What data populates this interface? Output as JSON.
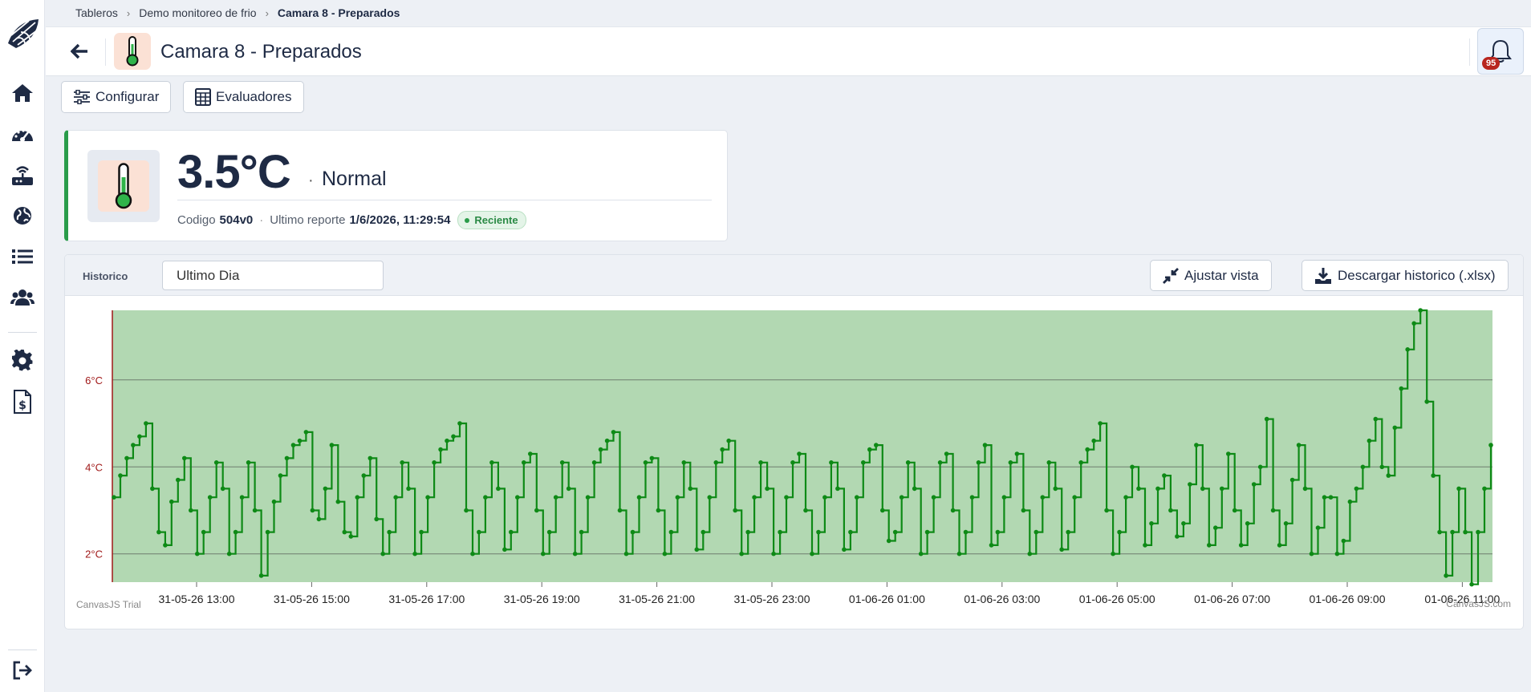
{
  "breadcrumb": [
    {
      "label": "Tableros"
    },
    {
      "label": "Demo monitoreo de frio"
    },
    {
      "label": "Camara 8 - Preparados"
    }
  ],
  "header": {
    "title": "Camara 8 - Preparados",
    "notifications_count": "95"
  },
  "toolbar": {
    "configure_label": "Configurar",
    "evaluators_label": "Evaluadores"
  },
  "status": {
    "temperature": "3.5°C",
    "separator": "·",
    "state": "Normal",
    "code_label": "Codigo",
    "code_value": "504v0",
    "report_label": "Ultimo reporte",
    "report_value": "1/6/2026, 11:29:54",
    "recent_label": "Reciente",
    "accent_color": "#2a9c4a"
  },
  "history": {
    "label": "Historico",
    "range_value": "Ultimo Dia",
    "fit_view_label": "Ajustar vista",
    "download_label": "Descargar historico (.xlsx)"
  },
  "sidebar": {
    "items": [
      {
        "icon": "home-icon"
      },
      {
        "icon": "dashboard-gauge-icon"
      },
      {
        "icon": "router-icon"
      },
      {
        "icon": "globe-icon"
      },
      {
        "icon": "list-icon"
      },
      {
        "icon": "users-icon"
      },
      {
        "icon": "gear-icon"
      },
      {
        "icon": "invoice-icon"
      }
    ],
    "logout_icon": "logout-icon"
  },
  "chart_data": {
    "type": "line",
    "step": true,
    "title": "",
    "xlabel": "",
    "ylabel": "",
    "x_start": "31-05-26 11:34",
    "x_end": "01-06-26 11:29",
    "ylim": [
      1.35,
      7.6
    ],
    "y_ticks": [
      "2°C",
      "4°C",
      "6°C"
    ],
    "y_tick_values": [
      2,
      4,
      6
    ],
    "x_tick_labels": [
      "31-05-26 13:00",
      "31-05-26 15:00",
      "31-05-26 17:00",
      "31-05-26 19:00",
      "31-05-26 21:00",
      "31-05-26 23:00",
      "01-06-26 01:00",
      "01-06-26 03:00",
      "01-06-26 05:00",
      "01-06-26 07:00",
      "01-06-26 09:00",
      "01-06-26 11:00"
    ],
    "normal_band_color": "#b2d8b2",
    "line_color": "#0e8a16",
    "grid": true,
    "watermark_left": "CanvasJS Trial",
    "watermark_right": "CanvasJS.com",
    "series": [
      {
        "values": [
          3.3,
          3.8,
          4.2,
          4.5,
          4.7,
          5.0,
          3.5,
          2.5,
          2.2,
          3.2,
          3.7,
          4.2,
          3.0,
          2.0,
          2.5,
          3.3,
          4.1,
          3.5,
          2.0,
          2.5,
          3.3,
          4.1,
          3.0,
          1.5,
          2.5,
          3.2,
          3.8,
          4.2,
          4.5,
          4.6,
          4.8,
          3.0,
          2.8,
          3.5,
          4.5,
          3.2,
          2.5,
          2.4,
          3.3,
          3.8,
          4.2,
          2.8,
          2.0,
          2.5,
          3.3,
          4.1,
          3.5,
          2.0,
          2.5,
          3.3,
          4.1,
          4.4,
          4.6,
          4.7,
          5.0,
          3.0,
          2.0,
          2.5,
          3.3,
          4.1,
          3.5,
          2.1,
          2.5,
          3.3,
          4.1,
          4.3,
          3.0,
          2.0,
          2.5,
          3.3,
          4.1,
          3.5,
          2.0,
          2.5,
          3.3,
          4.1,
          4.4,
          4.6,
          4.8,
          3.0,
          2.0,
          2.5,
          3.3,
          4.1,
          4.2,
          3.0,
          2.0,
          2.5,
          3.3,
          4.1,
          3.5,
          2.1,
          2.5,
          3.3,
          4.1,
          4.4,
          4.6,
          3.0,
          2.0,
          2.5,
          3.3,
          4.1,
          3.5,
          2.0,
          2.5,
          3.3,
          4.1,
          4.3,
          3.0,
          2.0,
          2.5,
          3.3,
          4.1,
          3.5,
          2.1,
          2.5,
          3.3,
          4.1,
          4.4,
          4.5,
          3.0,
          2.3,
          2.5,
          3.3,
          4.1,
          3.5,
          2.0,
          2.5,
          3.3,
          4.1,
          4.3,
          3.0,
          2.0,
          2.5,
          3.3,
          4.1,
          4.5,
          2.2,
          2.5,
          3.3,
          4.1,
          4.3,
          3.0,
          2.0,
          2.5,
          3.3,
          4.1,
          3.5,
          2.1,
          2.5,
          3.3,
          4.1,
          4.4,
          4.6,
          5.0,
          3.0,
          2.0,
          2.5,
          3.3,
          4.0,
          3.5,
          2.2,
          2.7,
          3.5,
          3.8,
          3.0,
          2.4,
          2.7,
          3.6,
          4.5,
          3.5,
          2.2,
          2.6,
          3.5,
          4.3,
          3.0,
          2.2,
          2.7,
          3.6,
          4.0,
          5.1,
          3.0,
          2.2,
          2.7,
          3.7,
          4.5,
          3.5,
          2.0,
          2.6,
          3.3,
          3.3,
          2.0,
          2.3,
          3.2,
          3.5,
          4.0,
          4.6,
          5.1,
          4.0,
          3.8,
          4.9,
          5.8,
          6.7,
          7.3,
          7.6,
          5.5,
          3.8,
          2.5,
          1.5,
          2.5,
          3.5,
          2.5,
          1.3,
          2.5,
          3.5,
          4.5
        ]
      }
    ]
  }
}
